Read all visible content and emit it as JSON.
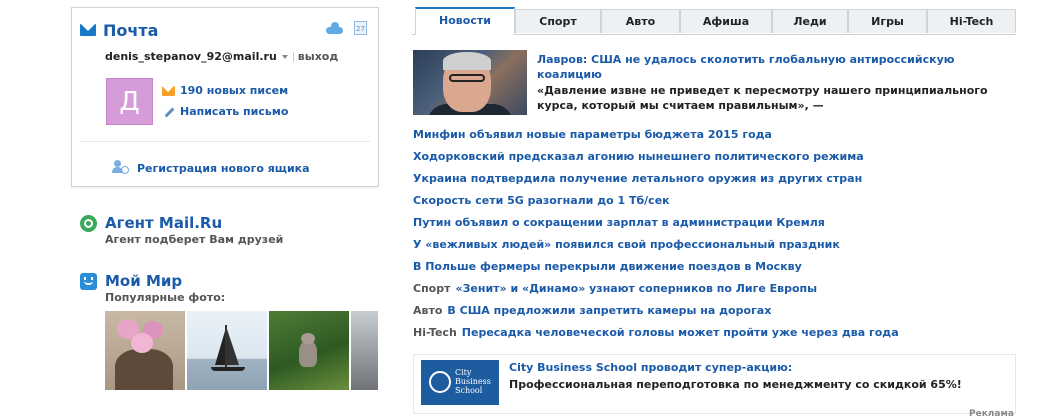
{
  "mail": {
    "title": "Почта",
    "email": "denis_stepanov_92@mail.ru",
    "logout": "выход",
    "avatar_letter": "Д",
    "avatar_color": "#d69cd9",
    "new_mail": "190 новых писем",
    "write": "Написать письмо",
    "register": "Регистрация нового ящика",
    "calendar_day": "27",
    "icons": [
      "envelope-icon",
      "cloud-icon",
      "calendar-icon",
      "pencil-icon",
      "user-add-icon"
    ]
  },
  "agent": {
    "title": "Агент Mail.Ru",
    "subtitle": "Агент подберет Вам друзей",
    "icon": "agent-icon"
  },
  "myworld": {
    "title": "Мой Мир",
    "photos_label": "Популярные фото:",
    "icon": "smile-icon"
  },
  "tabs": [
    {
      "label": "Новости",
      "active": true
    },
    {
      "label": "Спорт",
      "active": false
    },
    {
      "label": "Авто",
      "active": false
    },
    {
      "label": "Афиша",
      "active": false
    },
    {
      "label": "Леди",
      "active": false
    },
    {
      "label": "Игры",
      "active": false
    },
    {
      "label": "Hi-Tech",
      "active": false
    }
  ],
  "top_news": {
    "headline": "Лавров: США не удалось сколотить глобальную антироссийскую коалицию",
    "quote": "«Давление извне не приведет к пересмотру нашего принципиального курса, который мы считаем правильным», —"
  },
  "news": [
    {
      "rubric": "",
      "text": "Минфин объявил новые параметры бюджета 2015 года"
    },
    {
      "rubric": "",
      "text": "Ходорковский предсказал агонию нынешнего политического режима"
    },
    {
      "rubric": "",
      "text": "Украина подтвердила получение летального оружия из других стран"
    },
    {
      "rubric": "",
      "text": "Скорость сети 5G разогнали до 1 Тб/сек"
    },
    {
      "rubric": "",
      "text": "Путин объявил о сокращении зарплат в администрации Кремля"
    },
    {
      "rubric": "",
      "text": "У «вежливых людей» появился свой профессиональный праздник"
    },
    {
      "rubric": "",
      "text": "В Польше фермеры перекрыли движение поездов в Москву"
    },
    {
      "rubric": "Спорт",
      "text": "«Зенит» и «Динамо» узнают соперников по Лиге Европы"
    },
    {
      "rubric": "Авто",
      "text": "В США предложили запретить камеры на дорогах"
    },
    {
      "rubric": "Hi-Tech",
      "text": "Пересадка человеческой головы может пройти уже через два года"
    }
  ],
  "ad": {
    "logo_text": "City Business School",
    "title": "City Business School проводит супер-акцию:",
    "text": "Профессиональная переподготовка по менеджменту со скидкой 65%!",
    "label": "Реклама"
  },
  "colors": {
    "link": "#1a5aa8",
    "accent": "#1a78c8",
    "tab_bg": "#eef1f4"
  }
}
